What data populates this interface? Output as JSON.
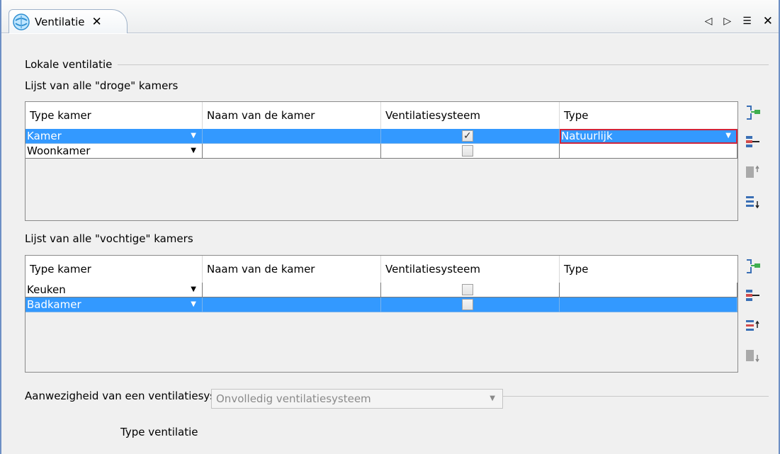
{
  "window": {
    "tab_title": "Ventilatie",
    "tab_close": "✕",
    "controls": {
      "back": "◁",
      "forward": "▷",
      "menu": "☰",
      "close": "✕"
    }
  },
  "section_local": {
    "title": "Lokale ventilatie"
  },
  "dry_rooms": {
    "label": "Lijst van alle \"droge\" kamers",
    "columns": [
      "Type kamer",
      "Naam van de kamer",
      "Ventilatiesysteem",
      "Type"
    ],
    "rows": [
      {
        "type_kamer": "Kamer",
        "naam": "",
        "ventilatiesysteem": true,
        "type": "Natuurlijk",
        "selected": true
      },
      {
        "type_kamer": "Woonkamer",
        "naam": "",
        "ventilatiesysteem": false,
        "type": "",
        "selected": false
      }
    ]
  },
  "wet_rooms": {
    "label": "Lijst van alle \"vochtige\" kamers",
    "columns": [
      "Type kamer",
      "Naam van de kamer",
      "Ventilatiesysteem",
      "Type"
    ],
    "rows": [
      {
        "type_kamer": "Keuken",
        "naam": "",
        "ventilatiesysteem": false,
        "type": "",
        "selected": false
      },
      {
        "type_kamer": "Badkamer",
        "naam": "",
        "ventilatiesysteem": false,
        "type": "",
        "selected": true
      }
    ]
  },
  "section_system": {
    "title": "Aanwezigheid van een ventilatiesysteem"
  },
  "type_ventilatie": {
    "label": "Type ventilatie",
    "value": "Onvolledig ventilatiesysteem"
  },
  "icons": {
    "tab": "ventilation-icon",
    "add": "add-row-icon",
    "remove": "remove-row-icon",
    "up": "move-up-icon",
    "down": "move-down-icon",
    "dropdown": "chevron-down-icon"
  },
  "colors": {
    "selection": "#3399ff",
    "active_cell_border": "#d0243a",
    "window_border": "#6d8fc4"
  }
}
